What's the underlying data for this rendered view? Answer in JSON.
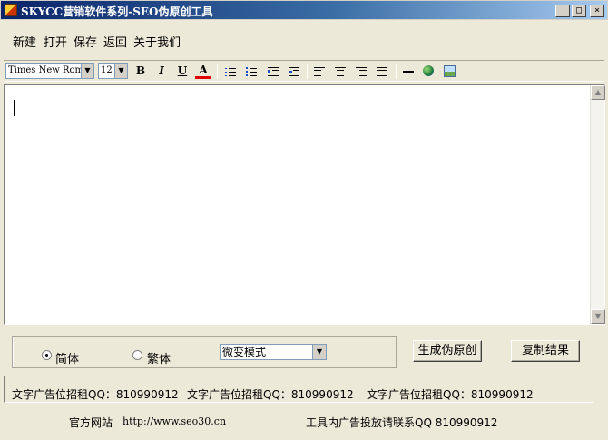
{
  "window": {
    "title": "SKYCC营销软件系列-SEO伪原创工具",
    "controls": {
      "minimize": "_",
      "maximize": "□",
      "close": "×"
    }
  },
  "menu": [
    "新建",
    "打开",
    "保存",
    "返回",
    "关于我们"
  ],
  "toolbar": {
    "font_family": "Times New Rom",
    "font_size": "12",
    "bold": "B",
    "italic": "I",
    "underline": "U",
    "font_color": "A",
    "icons": [
      "ordered-list-icon",
      "unordered-list-icon",
      "outdent-icon",
      "indent-icon",
      "align-left-icon",
      "align-center-icon",
      "align-right-icon",
      "justify-icon",
      "horizontal-rule-icon",
      "insert-link-icon",
      "insert-image-icon"
    ]
  },
  "editor": {
    "content": ""
  },
  "options": {
    "simplified_label": "简体",
    "traditional_label": "繁体",
    "selected": "simplified",
    "mode_selected": "微变模式"
  },
  "actions": {
    "generate": "生成伪原创",
    "copy": "复制结果"
  },
  "ads": [
    "文字广告位招租QQ：810990912",
    "文字广告位招租QQ：810990912",
    "文字广告位招租QQ：810990912"
  ],
  "footer": {
    "site_label": "官方网站",
    "site_url": "http://www.seo30.cn",
    "contact": "工具内广告投放请联系QQ 810990912"
  },
  "colors": {
    "titlebar_start": "#0a246a",
    "titlebar_end": "#a6caf0",
    "face": "#ece9d8"
  }
}
